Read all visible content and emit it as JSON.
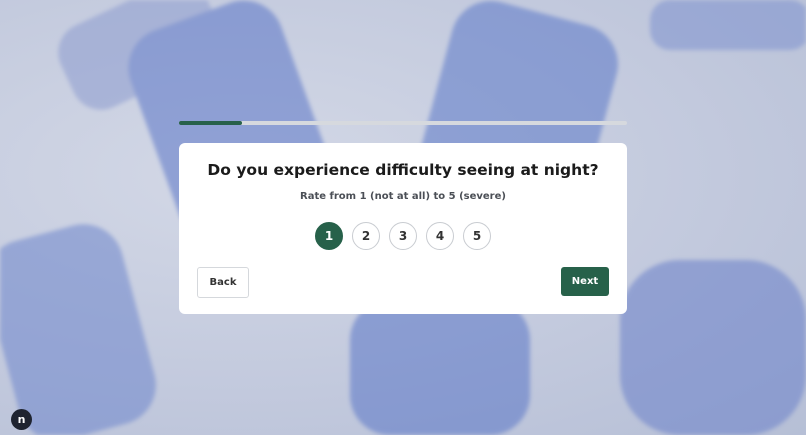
{
  "progress": {
    "fraction": 0.14
  },
  "question": {
    "title": "Do you experience difficulty seeing at night?",
    "hint": "Rate from 1 (not at all) to 5 (severe)"
  },
  "options": [
    "1",
    "2",
    "3",
    "4",
    "5"
  ],
  "selected_option": "1",
  "buttons": {
    "back": "Back",
    "next": "Next"
  },
  "brand": {
    "logo_letter": "n"
  },
  "colors": {
    "accent": "#27614a"
  }
}
